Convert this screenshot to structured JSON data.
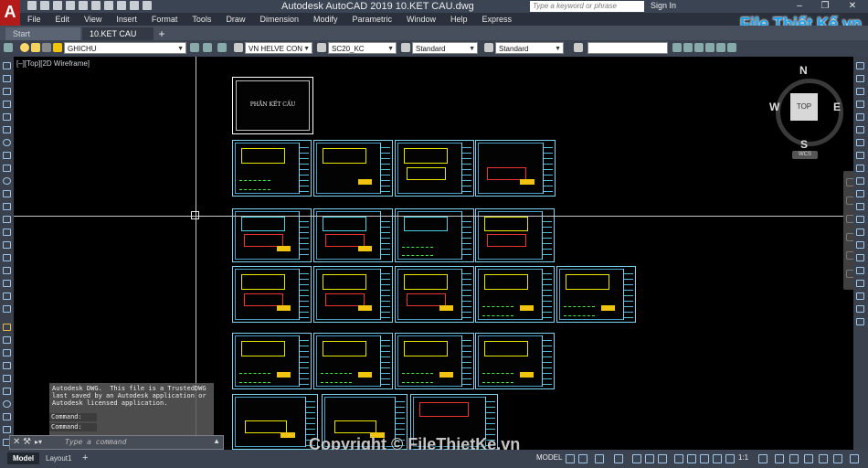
{
  "titlebar": {
    "app_letter": "A",
    "title": "Autodesk AutoCAD 2019    10.KET CAU.dwg",
    "search_placeholder": "Type a keyword or phrase",
    "signin": "Sign In",
    "help": "?"
  },
  "menu": [
    "File",
    "Edit",
    "View",
    "Insert",
    "Format",
    "Tools",
    "Draw",
    "Dimension",
    "Modify",
    "Parametric",
    "Window",
    "Help",
    "Express"
  ],
  "tabs": {
    "start": "Start",
    "file": "10.KET CAU",
    "new": "+"
  },
  "properties": {
    "layer": "GHICHU",
    "text_style": "VN HELVE CON",
    "dim_style": "SC20_KC",
    "table_style": "Standard",
    "multileader_style": "Standard",
    "layer_color": "#f1c40f"
  },
  "viewport": {
    "label": "[–][Top][2D Wireframe]"
  },
  "drawing": {
    "cover_title": "PHẦN KẾT CẤU"
  },
  "viewcube": {
    "top": "TOP",
    "north": "N",
    "south": "S",
    "east": "E",
    "west": "W",
    "wcs": "WCS"
  },
  "command": {
    "history": "Autodesk DWG.  This file is a TrustedDWG\nlast saved by an Autodesk application or\nAutodesk licensed application.",
    "line1": "Command:",
    "line2": "Command:",
    "placeholder": "Type a command",
    "close": "✕",
    "wrench": "⚒",
    "prompt": "▸▾"
  },
  "status": {
    "model_tab": "Model",
    "layout_tab": "Layout1",
    "add_tab": "+",
    "model_space": "MODEL",
    "anno_scale": "1:1"
  },
  "watermark": "Copyright © FileThietKe.vn",
  "brand": {
    "name": "File Thiết Kế.vn"
  }
}
